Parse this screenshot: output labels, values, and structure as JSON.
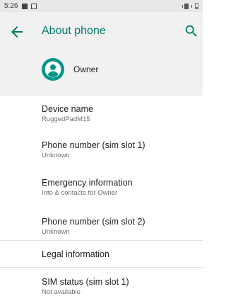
{
  "status_bar": {
    "time": "5:26",
    "icons": [
      "notification-icon",
      "notification-icon",
      "vibrate-icon",
      "battery-icon"
    ]
  },
  "toolbar": {
    "title": "About phone",
    "back_icon": "arrow-back-icon",
    "search_icon": "search-icon",
    "accent_color": "#00796b"
  },
  "owner": {
    "name": "Owner",
    "avatar_icon": "account-circle-icon",
    "avatar_color": "#009688"
  },
  "items": [
    {
      "title": "Device name",
      "subtitle": "RuggedPadM15"
    },
    {
      "title": "Phone number (sim slot 1)",
      "subtitle": "Unknown"
    },
    {
      "title": "Emergency information",
      "subtitle": "Info & contacts for Owner"
    },
    {
      "title": "Phone number (sim slot 2)",
      "subtitle": "Unknown"
    },
    {
      "title": "Legal information"
    },
    {
      "title": "SIM status (sim slot 1)",
      "subtitle": "Not available"
    }
  ]
}
